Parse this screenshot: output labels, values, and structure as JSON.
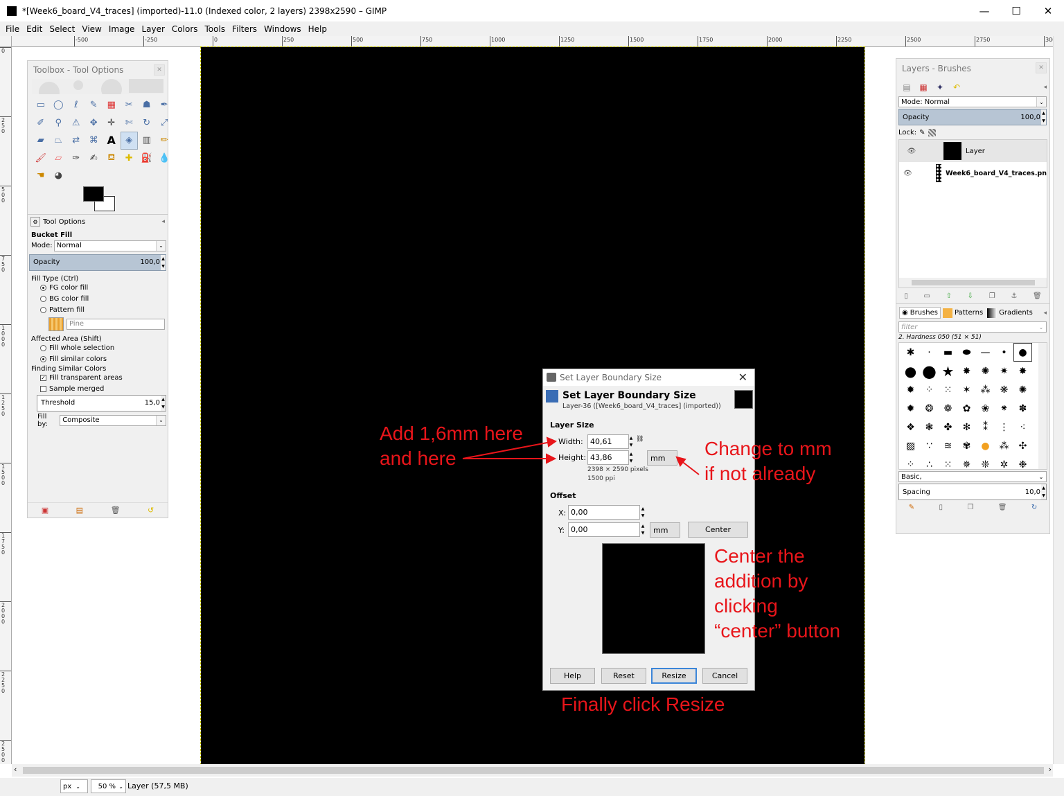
{
  "window": {
    "title": "*[Week6_board_V4_traces] (imported)-11.0 (Indexed color, 2 layers) 2398x2590 – GIMP",
    "minimize": "—",
    "maximize": "☐",
    "close": "✕"
  },
  "menu": [
    "File",
    "Edit",
    "Select",
    "View",
    "Image",
    "Layer",
    "Colors",
    "Tools",
    "Filters",
    "Windows",
    "Help"
  ],
  "ruler": {
    "h_labels": [
      "-500",
      "-250",
      "0",
      "250",
      "500",
      "750",
      "1000",
      "1250",
      "1500",
      "1750",
      "2000",
      "2250",
      "2500",
      "2750",
      "3000"
    ],
    "v_labels": [
      "0",
      "250",
      "500",
      "750",
      "1000",
      "1250",
      "1500",
      "1750",
      "2000",
      "2250",
      "2500"
    ]
  },
  "toolbox": {
    "title": "Toolbox - Tool Options",
    "tool_options_tab": "Tool Options",
    "tool_name": "Bucket Fill",
    "mode_label": "Mode:",
    "mode_value": "Normal",
    "opacity_label": "Opacity",
    "opacity_value": "100,0",
    "fill_type_label": "Fill Type  (Ctrl)",
    "fill_types": [
      "FG color fill",
      "BG color fill",
      "Pattern fill"
    ],
    "fill_type_selected": 0,
    "pattern_name": "Pine",
    "affected_label": "Affected Area  (Shift)",
    "affected_options": [
      "Fill whole selection",
      "Fill similar colors"
    ],
    "affected_selected": 1,
    "similar_label": "Finding Similar Colors",
    "fill_transparent": "Fill transparent areas",
    "fill_transparent_checked": true,
    "sample_merged": "Sample merged",
    "sample_merged_checked": false,
    "threshold_label": "Threshold",
    "threshold_value": "15,0",
    "fill_by_label": "Fill by:",
    "fill_by_value": "Composite"
  },
  "layers": {
    "title": "Layers - Brushes",
    "mode_label": "Mode: Normal",
    "opacity_label": "Opacity",
    "opacity_value": "100,0",
    "lock_label": "Lock:",
    "items": [
      {
        "name": "Layer",
        "bold": false
      },
      {
        "name": "Week6_board_V4_traces.pn",
        "bold": true
      }
    ],
    "brush_tabs": [
      "Brushes",
      "Patterns",
      "Gradients"
    ],
    "filter_placeholder": "filter",
    "brush_name": "2. Hardness 050 (51 × 51)",
    "brush_preset": "Basic,",
    "spacing_label": "Spacing",
    "spacing_value": "10,0"
  },
  "dialog": {
    "window_title": "Set Layer Boundary Size",
    "heading": "Set Layer Boundary Size",
    "subheading": "Layer-36 ([Week6_board_V4_traces] (imported))",
    "layer_size_label": "Layer Size",
    "width_label": "Width:",
    "width_value": "40,61",
    "height_label": "Height:",
    "height_value": "43,86",
    "size_unit": "mm",
    "pixels_info": "2398 × 2590 pixels",
    "ppi_info": "1500 ppi",
    "offset_label": "Offset",
    "x_label": "X:",
    "x_value": "0,00",
    "y_label": "Y:",
    "y_value": "0,00",
    "offset_unit": "mm",
    "center_button": "Center",
    "help_button": "Help",
    "reset_button": "Reset",
    "resize_button": "Resize",
    "cancel_button": "Cancel"
  },
  "annotations": {
    "add_line1": "Add 1,6mm here",
    "add_line2": "and here",
    "change_line1": "Change to mm",
    "change_line2": "if not already",
    "center_line1": "Center the",
    "center_line2": "addition by",
    "center_line3": "clicking",
    "center_line4": "“center” button",
    "finally": "Finally click Resize",
    "color": "#e8151a"
  },
  "status": {
    "unit": "px",
    "zoom": "50 %",
    "info": "Layer (57,5 MB)"
  }
}
